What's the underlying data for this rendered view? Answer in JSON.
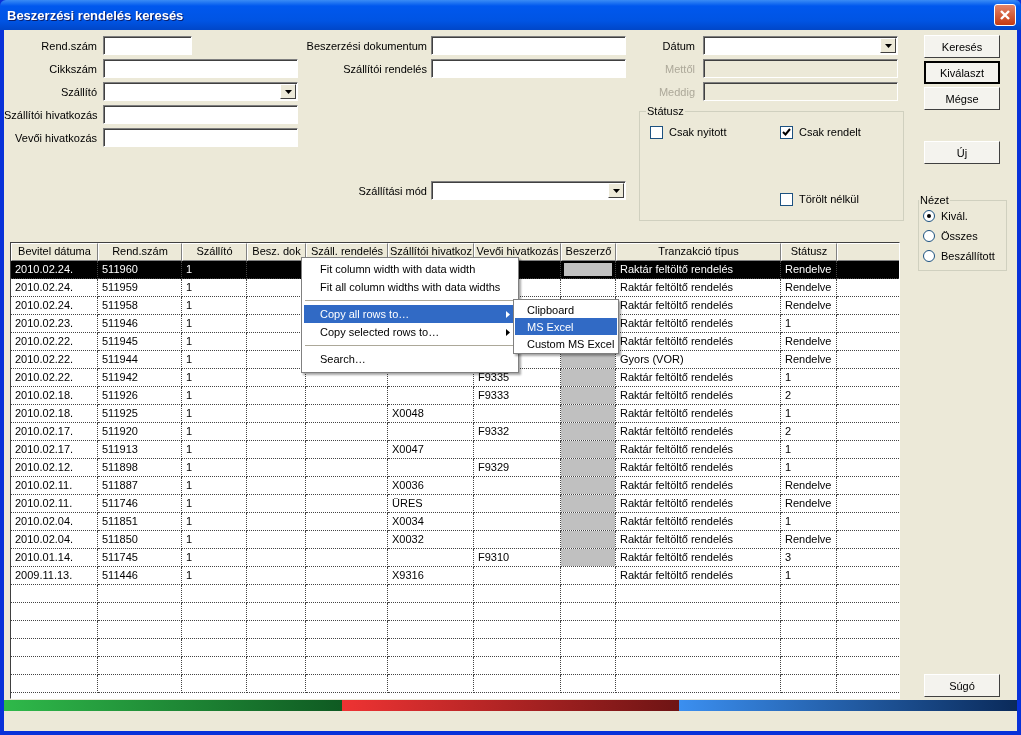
{
  "window": {
    "title": "Beszerzési rendelés keresés"
  },
  "left_fields": [
    {
      "label": "Rend.szám",
      "kind": "text",
      "short": true
    },
    {
      "label": "Cikkszám",
      "kind": "text",
      "short": false
    },
    {
      "label": "Szállító",
      "kind": "combo",
      "short": false
    },
    {
      "label": "Szállítói hivatkozás",
      "kind": "text",
      "short": false
    },
    {
      "label": "Vevői hivatkozás",
      "kind": "text",
      "short": false
    }
  ],
  "middle_fields": [
    {
      "label": "Beszerzési dokumentum",
      "kind": "text"
    },
    {
      "label": "Szállítói rendelés",
      "kind": "text"
    }
  ],
  "delivery_mode": {
    "label": "Szállítási mód",
    "kind": "combo"
  },
  "date_fields": [
    {
      "label": "Dátum",
      "kind": "combo",
      "disabled": false
    },
    {
      "label": "Mettől",
      "kind": "text",
      "disabled": true
    },
    {
      "label": "Meddig",
      "kind": "text",
      "disabled": true
    }
  ],
  "status_group": {
    "title": "Státusz",
    "options": [
      {
        "label": "Csak nyitott",
        "checked": false
      },
      {
        "label": "Csak rendelt",
        "checked": true
      },
      {
        "label": "Törölt nélkül",
        "checked": false
      }
    ]
  },
  "buttons": [
    {
      "label": "Keresés",
      "default": false
    },
    {
      "label": "Kiválaszt",
      "default": true
    },
    {
      "label": "Mégse",
      "default": false
    }
  ],
  "new_button": {
    "label": "Új"
  },
  "view_group": {
    "title": "Nézet",
    "options": [
      {
        "label": "Kivál.",
        "selected": true
      },
      {
        "label": "Összes",
        "selected": false
      },
      {
        "label": "Beszállított",
        "selected": false
      }
    ]
  },
  "help_button": {
    "label": "Súgó"
  },
  "table": {
    "columns": [
      "Bevitel dátuma",
      "Rend.szám",
      "Szállító",
      "Besz. dok",
      "Száll. rendelés",
      "Szállítói hivatkoz",
      "Vevői hivatkozás",
      "Beszerző",
      "Tranzakció típus",
      "Státusz"
    ],
    "rows": [
      {
        "selected": true,
        "buyer_shaded": true,
        "cells": [
          "2010.02.24.",
          "511960",
          "1",
          null,
          null,
          null,
          null,
          null,
          "Raktár feltöltő rendelés",
          "Rendelve"
        ]
      },
      {
        "selected": false,
        "buyer_shaded": false,
        "cells": [
          "2010.02.24.",
          "511959",
          "1",
          null,
          null,
          null,
          null,
          null,
          "Raktár feltöltő rendelés",
          "Rendelve"
        ]
      },
      {
        "selected": false,
        "cells": [
          "2010.02.24.",
          "511958",
          "1",
          null,
          null,
          null,
          null,
          null,
          "Raktár feltöltő rendelés",
          "Rendelve"
        ]
      },
      {
        "selected": false,
        "cells": [
          "2010.02.23.",
          "511946",
          "1",
          null,
          null,
          null,
          null,
          null,
          "Raktár feltöltő rendelés",
          "1"
        ]
      },
      {
        "selected": false,
        "cells": [
          "2010.02.22.",
          "511945",
          "1",
          null,
          null,
          null,
          null,
          null,
          "Raktár feltöltő rendelés",
          "Rendelve"
        ]
      },
      {
        "selected": false,
        "buyer_shaded": true,
        "cells": [
          "2010.02.22.",
          "511944",
          "1",
          null,
          null,
          null,
          null,
          null,
          "Gyors (VOR)",
          "Rendelve"
        ]
      },
      {
        "selected": false,
        "buyer_shaded": true,
        "cells": [
          "2010.02.22.",
          "511942",
          "1",
          null,
          null,
          null,
          "F9335",
          null,
          "Raktár feltöltő rendelés",
          "1"
        ]
      },
      {
        "selected": false,
        "buyer_shaded": true,
        "cells": [
          "2010.02.18.",
          "511926",
          "1",
          null,
          null,
          null,
          "F9333",
          null,
          "Raktár feltöltő rendelés",
          "2"
        ]
      },
      {
        "selected": false,
        "buyer_shaded": true,
        "cells": [
          "2010.02.18.",
          "511925",
          "1",
          null,
          null,
          "X0048",
          null,
          null,
          "Raktár feltöltő rendelés",
          "1"
        ]
      },
      {
        "selected": false,
        "buyer_shaded": true,
        "cells": [
          "2010.02.17.",
          "511920",
          "1",
          null,
          null,
          null,
          "F9332",
          null,
          "Raktár feltöltő rendelés",
          "2"
        ]
      },
      {
        "selected": false,
        "buyer_shaded": true,
        "cells": [
          "2010.02.17.",
          "511913",
          "1",
          null,
          null,
          "X0047",
          null,
          null,
          "Raktár feltöltő rendelés",
          "1"
        ]
      },
      {
        "selected": false,
        "buyer_shaded": true,
        "cells": [
          "2010.02.12.",
          "511898",
          "1",
          null,
          null,
          null,
          "F9329",
          null,
          "Raktár feltöltő rendelés",
          "1"
        ]
      },
      {
        "selected": false,
        "buyer_shaded": true,
        "cells": [
          "2010.02.11.",
          "511887",
          "1",
          null,
          null,
          "X0036",
          null,
          null,
          "Raktár feltöltő rendelés",
          "Rendelve"
        ]
      },
      {
        "selected": false,
        "buyer_shaded": true,
        "cells": [
          "2010.02.11.",
          "511746",
          "1",
          null,
          null,
          "ÜRES",
          null,
          null,
          "Raktár feltöltő rendelés",
          "Rendelve"
        ]
      },
      {
        "selected": false,
        "buyer_shaded": true,
        "cells": [
          "2010.02.04.",
          "511851",
          "1",
          null,
          null,
          "X0034",
          null,
          null,
          "Raktár feltöltő rendelés",
          "1"
        ]
      },
      {
        "selected": false,
        "buyer_shaded": true,
        "cells": [
          "2010.02.04.",
          "511850",
          "1",
          null,
          null,
          "X0032",
          null,
          null,
          "Raktár feltöltő rendelés",
          "Rendelve"
        ]
      },
      {
        "selected": false,
        "buyer_shaded": true,
        "cells": [
          "2010.01.14.",
          "511745",
          "1",
          null,
          null,
          null,
          "F9310",
          null,
          "Raktár feltöltő rendelés",
          "3"
        ]
      },
      {
        "selected": false,
        "buyer_shaded": false,
        "cells": [
          "2009.11.13.",
          "511446",
          "1",
          null,
          null,
          "X9316",
          null,
          null,
          "Raktár feltöltő rendelés",
          "1"
        ]
      }
    ]
  },
  "context_menu": {
    "items": [
      {
        "kind": "item",
        "label": "Fit column width with data width",
        "selected": false
      },
      {
        "kind": "item",
        "label": "Fit all column widths with data widths",
        "selected": false
      },
      {
        "kind": "separator"
      },
      {
        "kind": "submenu",
        "label": "Copy all rows to…",
        "selected": true
      },
      {
        "kind": "submenu",
        "label": "Copy selected rows to…",
        "selected": false
      },
      {
        "kind": "separator"
      },
      {
        "kind": "item",
        "label": "Search…",
        "selected": false
      }
    ],
    "submenu": [
      {
        "label": "Clipboard",
        "selected": false
      },
      {
        "label": "MS Excel",
        "selected": true
      },
      {
        "label": "Custom MS Excel",
        "selected": false
      }
    ]
  }
}
